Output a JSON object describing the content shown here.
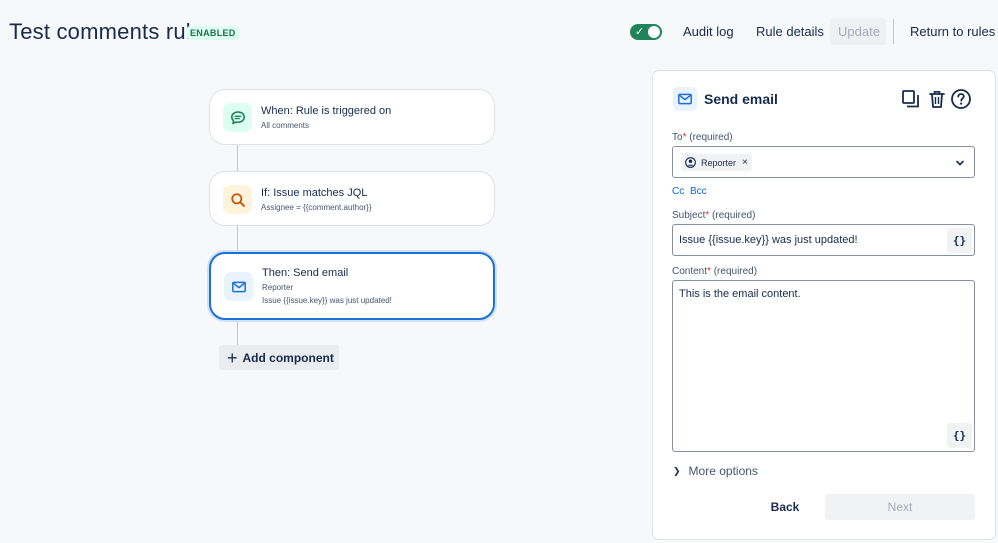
{
  "header": {
    "title": "Test comments rule",
    "status": "ENABLED",
    "enabled_toggle": true,
    "audit_log_label": "Audit log",
    "rule_details_label": "Rule details",
    "update_label": "Update",
    "return_label": "Return to rules"
  },
  "flow": {
    "trigger": {
      "title": "When: Rule is triggered on",
      "subtitle": "All comments",
      "icon": "comment-icon"
    },
    "condition": {
      "title": "If: Issue matches JQL",
      "subtitle": "Assignee = {{comment.author}}",
      "icon": "search-icon"
    },
    "action": {
      "title": "Then: Send email",
      "line1": "Reporter",
      "line2": "Issue {{issue.key}} was just updated!",
      "icon": "mail-icon"
    },
    "add_component_label": "Add component"
  },
  "panel": {
    "title": "Send email",
    "to": {
      "label": "To",
      "required": "(required)",
      "chip": "Reporter"
    },
    "cc_label": "Cc",
    "bcc_label": "Bcc",
    "subject": {
      "label": "Subject",
      "required": "(required)",
      "value": "Issue {{issue.key}} was just updated!"
    },
    "content": {
      "label": "Content",
      "required": "(required)",
      "value": "This is the email content."
    },
    "smart_value_label": "{}",
    "more_options_label": "More options",
    "back_label": "Back",
    "next_label": "Next"
  },
  "colors": {
    "accent": "#1d6fd8",
    "enabled_green": "#1f845a",
    "link_blue": "#0c66e4"
  }
}
